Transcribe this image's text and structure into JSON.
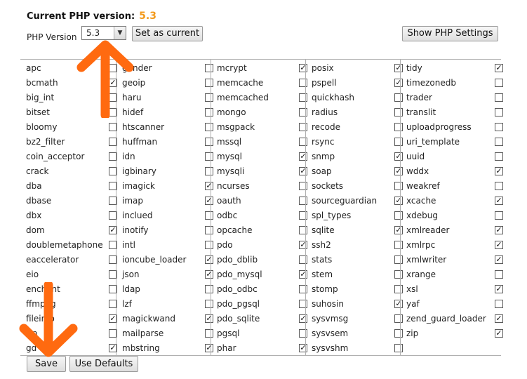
{
  "header": {
    "title": "Current PHP version:",
    "version": "5.3",
    "php_version_label": "PHP Version",
    "selected_version": "5.3",
    "set_current_label": "Set as current",
    "show_settings_label": "Show PHP Settings"
  },
  "footer": {
    "save_label": "Save",
    "defaults_label": "Use Defaults"
  },
  "colors": {
    "accent": "#f39a1c",
    "annotation_arrow": "#ff6a10"
  },
  "columns": [
    [
      {
        "name": "apc",
        "checked": false
      },
      {
        "name": "bcmath",
        "checked": true
      },
      {
        "name": "big_int",
        "checked": false
      },
      {
        "name": "bitset",
        "checked": false
      },
      {
        "name": "bloomy",
        "checked": false
      },
      {
        "name": "bz2_filter",
        "checked": false
      },
      {
        "name": "coin_acceptor",
        "checked": false
      },
      {
        "name": "crack",
        "checked": false
      },
      {
        "name": "dba",
        "checked": false
      },
      {
        "name": "dbase",
        "checked": false
      },
      {
        "name": "dbx",
        "checked": false
      },
      {
        "name": "dom",
        "checked": true
      },
      {
        "name": "doublemetaphone",
        "checked": false
      },
      {
        "name": "eaccelerator",
        "checked": false
      },
      {
        "name": "eio",
        "checked": false
      },
      {
        "name": "enchant",
        "checked": false
      },
      {
        "name": "ffmpeg",
        "checked": false
      },
      {
        "name": "fileinfo",
        "checked": true
      },
      {
        "name": "ftp",
        "checked": false
      },
      {
        "name": "gd",
        "checked": true
      }
    ],
    [
      {
        "name": "gender",
        "checked": false
      },
      {
        "name": "geoip",
        "checked": false
      },
      {
        "name": "haru",
        "checked": false
      },
      {
        "name": "hidef",
        "checked": false
      },
      {
        "name": "htscanner",
        "checked": false
      },
      {
        "name": "huffman",
        "checked": false
      },
      {
        "name": "idn",
        "checked": false
      },
      {
        "name": "igbinary",
        "checked": false
      },
      {
        "name": "imagick",
        "checked": true
      },
      {
        "name": "imap",
        "checked": true
      },
      {
        "name": "inclued",
        "checked": false
      },
      {
        "name": "inotify",
        "checked": false
      },
      {
        "name": "intl",
        "checked": false
      },
      {
        "name": "ioncube_loader",
        "checked": true
      },
      {
        "name": "json",
        "checked": true
      },
      {
        "name": "ldap",
        "checked": false
      },
      {
        "name": "lzf",
        "checked": false
      },
      {
        "name": "magickwand",
        "checked": true
      },
      {
        "name": "mailparse",
        "checked": false
      },
      {
        "name": "mbstring",
        "checked": true
      }
    ],
    [
      {
        "name": "mcrypt",
        "checked": true
      },
      {
        "name": "memcache",
        "checked": false
      },
      {
        "name": "memcached",
        "checked": false
      },
      {
        "name": "mongo",
        "checked": false
      },
      {
        "name": "msgpack",
        "checked": false
      },
      {
        "name": "mssql",
        "checked": false
      },
      {
        "name": "mysql",
        "checked": true
      },
      {
        "name": "mysqli",
        "checked": true
      },
      {
        "name": "ncurses",
        "checked": false
      },
      {
        "name": "oauth",
        "checked": false
      },
      {
        "name": "odbc",
        "checked": false
      },
      {
        "name": "opcache",
        "checked": false
      },
      {
        "name": "pdo",
        "checked": true
      },
      {
        "name": "pdo_dblib",
        "checked": false
      },
      {
        "name": "pdo_mysql",
        "checked": true
      },
      {
        "name": "pdo_odbc",
        "checked": false
      },
      {
        "name": "pdo_pgsql",
        "checked": false
      },
      {
        "name": "pdo_sqlite",
        "checked": true
      },
      {
        "name": "pgsql",
        "checked": false
      },
      {
        "name": "phar",
        "checked": true
      }
    ],
    [
      {
        "name": "posix",
        "checked": true
      },
      {
        "name": "pspell",
        "checked": true
      },
      {
        "name": "quickhash",
        "checked": false
      },
      {
        "name": "radius",
        "checked": false
      },
      {
        "name": "recode",
        "checked": false
      },
      {
        "name": "rsync",
        "checked": false
      },
      {
        "name": "snmp",
        "checked": true
      },
      {
        "name": "soap",
        "checked": true
      },
      {
        "name": "sockets",
        "checked": false
      },
      {
        "name": "sourceguardian",
        "checked": true
      },
      {
        "name": "spl_types",
        "checked": false
      },
      {
        "name": "sqlite",
        "checked": true
      },
      {
        "name": "ssh2",
        "checked": false
      },
      {
        "name": "stats",
        "checked": false
      },
      {
        "name": "stem",
        "checked": false
      },
      {
        "name": "stomp",
        "checked": false
      },
      {
        "name": "suhosin",
        "checked": true
      },
      {
        "name": "sysvmsg",
        "checked": false
      },
      {
        "name": "sysvsem",
        "checked": false
      },
      {
        "name": "sysvshm",
        "checked": false
      }
    ],
    [
      {
        "name": "tidy",
        "checked": true
      },
      {
        "name": "timezonedb",
        "checked": false
      },
      {
        "name": "trader",
        "checked": false
      },
      {
        "name": "translit",
        "checked": false
      },
      {
        "name": "uploadprogress",
        "checked": false
      },
      {
        "name": "uri_template",
        "checked": false
      },
      {
        "name": "uuid",
        "checked": false
      },
      {
        "name": "wddx",
        "checked": true
      },
      {
        "name": "weakref",
        "checked": false
      },
      {
        "name": "xcache",
        "checked": true
      },
      {
        "name": "xdebug",
        "checked": false
      },
      {
        "name": "xmlreader",
        "checked": true
      },
      {
        "name": "xmlrpc",
        "checked": true
      },
      {
        "name": "xmlwriter",
        "checked": true
      },
      {
        "name": "xrange",
        "checked": false
      },
      {
        "name": "xsl",
        "checked": true
      },
      {
        "name": "yaf",
        "checked": false
      },
      {
        "name": "zend_guard_loader",
        "checked": true
      },
      {
        "name": "zip",
        "checked": true
      }
    ]
  ]
}
